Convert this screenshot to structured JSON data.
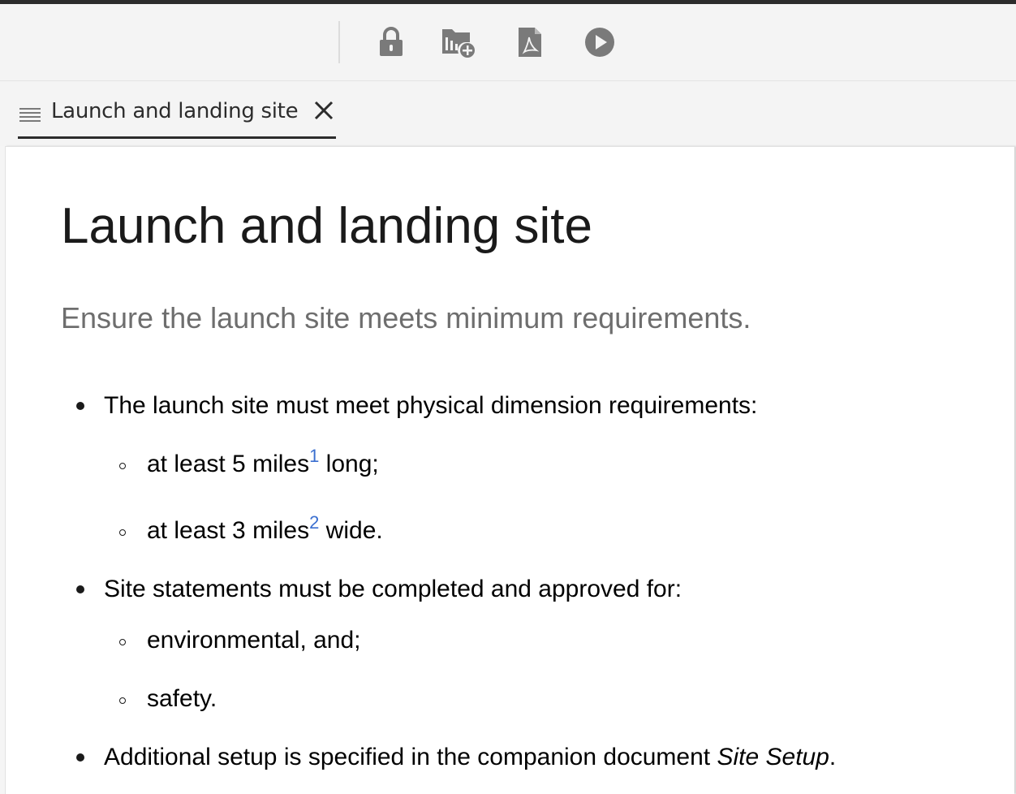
{
  "toolbar": {
    "buttons": [
      {
        "icon": "lock-icon",
        "label": "Lock"
      },
      {
        "icon": "add-to-folder-icon",
        "label": "Add to collection"
      },
      {
        "icon": "pdf-icon",
        "label": "PDF"
      },
      {
        "icon": "play-icon",
        "label": "Preview"
      }
    ]
  },
  "tab": {
    "icon": "topic-icon",
    "label": "Launch and landing site",
    "close_icon": "close-icon"
  },
  "document": {
    "title": "Launch and landing site",
    "shortdesc": "Ensure the launch site meets minimum requirements.",
    "items": [
      {
        "text": "The launch site must meet physical dimension requirements:",
        "subitems": [
          {
            "before": "at least 5 miles",
            "footnote": "1",
            "after": " long;"
          },
          {
            "before": "at least 3 miles",
            "footnote": "2",
            "after": " wide."
          }
        ]
      },
      {
        "text": "Site statements must be completed and approved for:",
        "subitems": [
          {
            "before": "environmental, and;"
          },
          {
            "before": "safety."
          }
        ]
      },
      {
        "text_before": "Additional setup is specified in the companion document ",
        "citation": "Site Setup",
        "text_after": "."
      }
    ]
  },
  "colors": {
    "text": "#1a1a1a",
    "shortdesc": "#6e6e6e",
    "footnote_link": "#3a6fd0",
    "icon_gray": "#7a7a7a",
    "tab_underline": "#2c2c2c"
  }
}
